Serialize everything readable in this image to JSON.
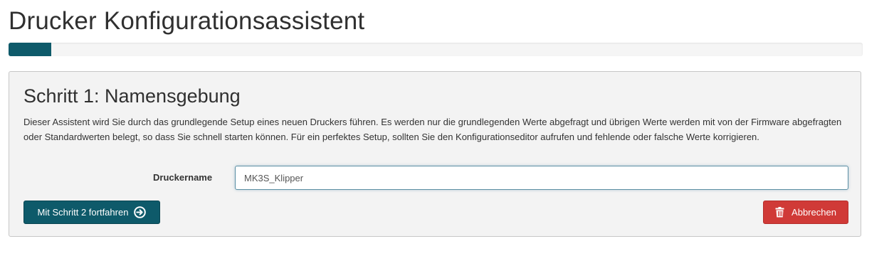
{
  "page": {
    "title": "Drucker Konfigurationsassistent"
  },
  "progress": {
    "fraction": 0.05,
    "color": "#0e5a6a"
  },
  "step": {
    "title": "Schritt 1: Namensgebung",
    "description": "Dieser Assistent wird Sie durch das grundlegende Setup eines neuen Druckers führen. Es werden nur die grundlegenden Werte abgefragt und übrigen Werte werden mit von der Firmware abgefragten oder Standardwerten belegt, so dass Sie schnell starten können. Für ein perfektes Setup, sollten Sie den Konfigurationseditor aufrufen und fehlende oder falsche Werte korrigieren."
  },
  "form": {
    "printer_name_label": "Druckername",
    "printer_name_value": "MK3S_Klipper"
  },
  "buttons": {
    "continue_label": "Mit Schritt 2 fortfahren",
    "continue_icon": "arrow-circle-right-icon",
    "cancel_label": "Abbrechen",
    "cancel_icon": "trash-icon"
  },
  "colors": {
    "primary": "#0e5a6a",
    "danger": "#d03a37"
  }
}
